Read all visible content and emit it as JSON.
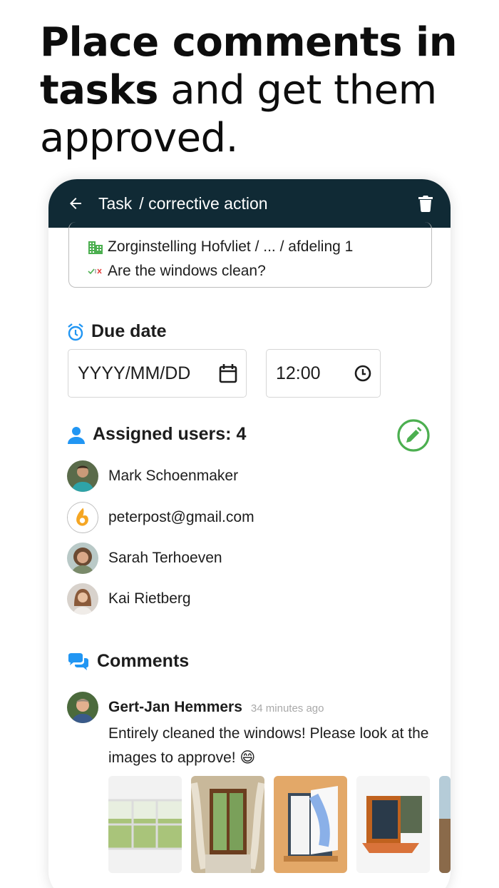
{
  "headline": {
    "bold1": "Place comments in",
    "bold2": "tasks",
    "rest": " and get them",
    "line3": "approved."
  },
  "appbar": {
    "title": "Task",
    "subtitle": "/ corrective action"
  },
  "context": {
    "location": "Zorginstelling Hofvliet / ... / afdeling 1",
    "question": "Are the windows clean?"
  },
  "due_date": {
    "label": "Due date",
    "date_placeholder": "YYYY/MM/DD",
    "time_value": "12:00"
  },
  "assigned": {
    "label": "Assigned users: 4",
    "users": [
      {
        "name": "Mark Schoenmaker"
      },
      {
        "name": "peterpost@gmail.com"
      },
      {
        "name": "Sarah Terhoeven"
      },
      {
        "name": "Kai Rietberg"
      }
    ]
  },
  "comments": {
    "label": "Comments",
    "items": [
      {
        "author": "Gert-Jan Hemmers",
        "time": "34 minutes ago",
        "text": "Entirely cleaned the windows! Please look at the images to approve! 😄"
      }
    ]
  },
  "colors": {
    "appbar": "#102a35",
    "accent_blue": "#2196f3",
    "accent_green": "#4caf50"
  }
}
